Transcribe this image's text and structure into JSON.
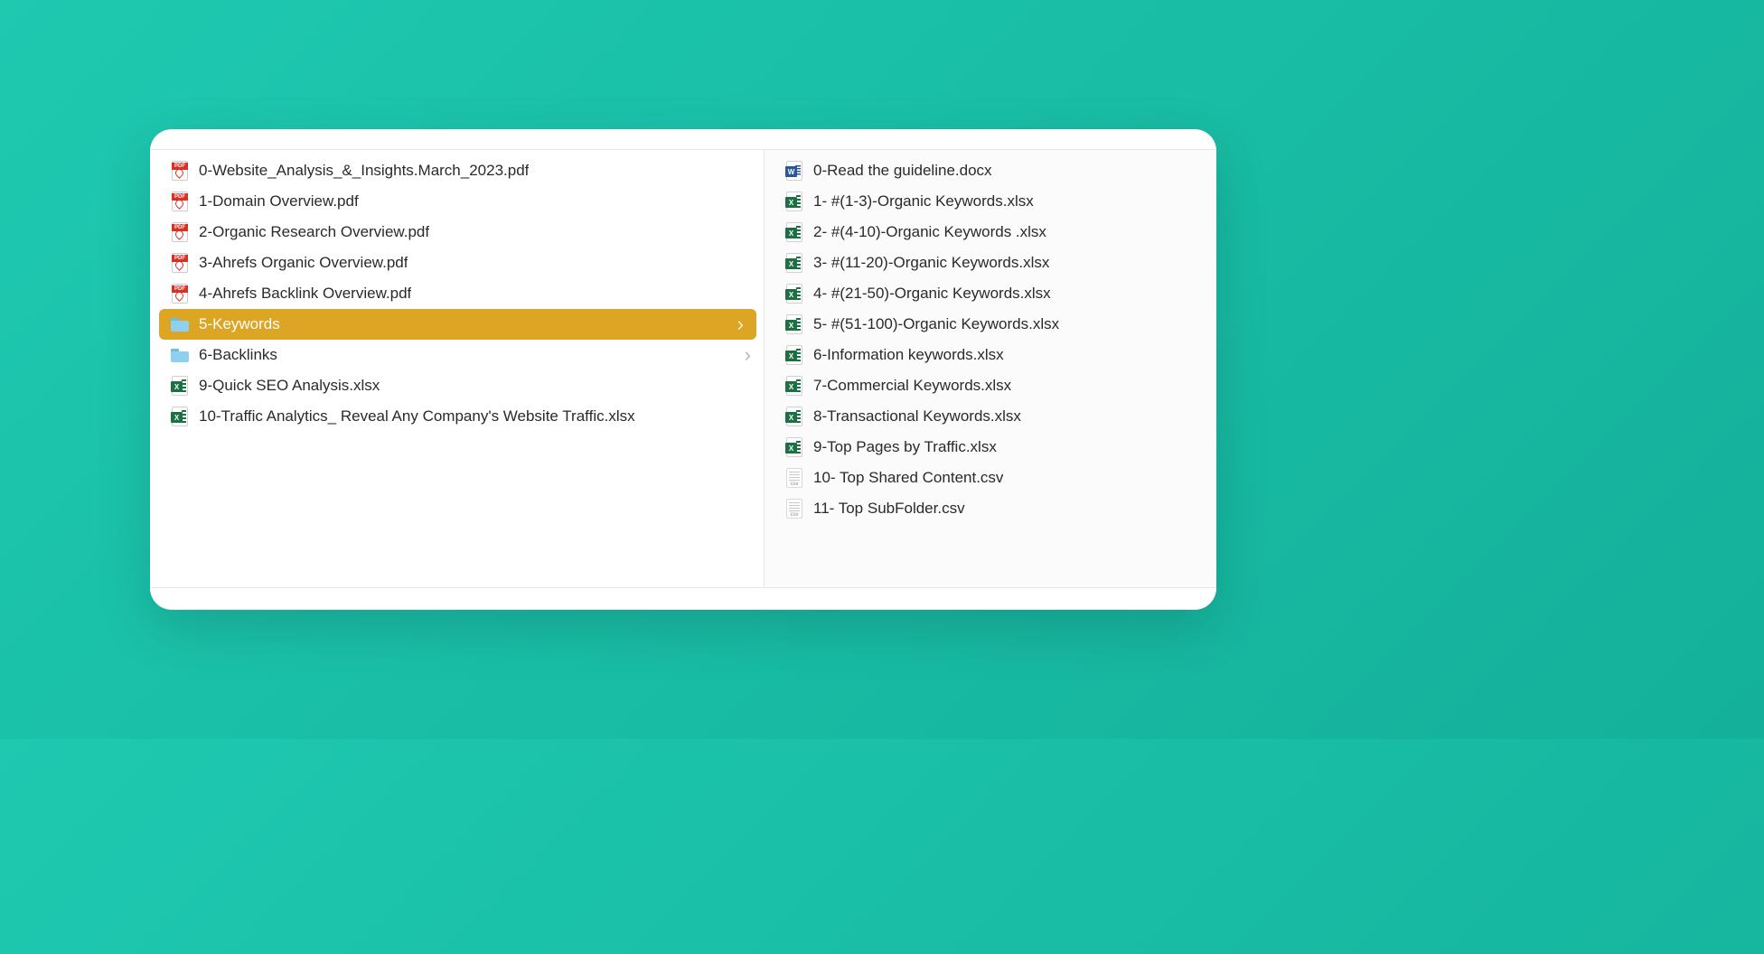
{
  "left_column": {
    "items": [
      {
        "name": "0-Website_Analysis_&_Insights.March_2023.pdf",
        "type": "pdf",
        "selected": false
      },
      {
        "name": "1-Domain Overview.pdf",
        "type": "pdf",
        "selected": false
      },
      {
        "name": "2-Organic Research Overview.pdf",
        "type": "pdf",
        "selected": false
      },
      {
        "name": "3-Ahrefs Organic Overview.pdf",
        "type": "pdf",
        "selected": false
      },
      {
        "name": "4-Ahrefs Backlink Overview.pdf",
        "type": "pdf",
        "selected": false
      },
      {
        "name": "5-Keywords",
        "type": "folder",
        "selected": true,
        "has_children": true
      },
      {
        "name": "6-Backlinks",
        "type": "folder",
        "selected": false,
        "has_children": true
      },
      {
        "name": "9-Quick SEO Analysis.xlsx",
        "type": "xlsx",
        "selected": false
      },
      {
        "name": "10-Traffic Analytics_ Reveal Any Company's Website Traffic.xlsx",
        "type": "xlsx",
        "selected": false
      }
    ]
  },
  "right_column": {
    "items": [
      {
        "name": "0-Read the guideline.docx",
        "type": "docx"
      },
      {
        "name": "1- #(1-3)-Organic Keywords.xlsx",
        "type": "xlsx"
      },
      {
        "name": "2- #(4-10)-Organic Keywords .xlsx",
        "type": "xlsx"
      },
      {
        "name": "3- #(11-20)-Organic Keywords.xlsx",
        "type": "xlsx"
      },
      {
        "name": "4- #(21-50)-Organic Keywords.xlsx",
        "type": "xlsx"
      },
      {
        "name": "5- #(51-100)-Organic Keywords.xlsx",
        "type": "xlsx"
      },
      {
        "name": "6-Information keywords.xlsx",
        "type": "xlsx"
      },
      {
        "name": "7-Commercial Keywords.xlsx",
        "type": "xlsx"
      },
      {
        "name": "8-Transactional Keywords.xlsx",
        "type": "xlsx"
      },
      {
        "name": "9-Top Pages by Traffic.xlsx",
        "type": "xlsx"
      },
      {
        "name": "10- Top Shared Content.csv",
        "type": "csv"
      },
      {
        "name": "11- Top SubFolder.csv",
        "type": "csv"
      }
    ]
  }
}
